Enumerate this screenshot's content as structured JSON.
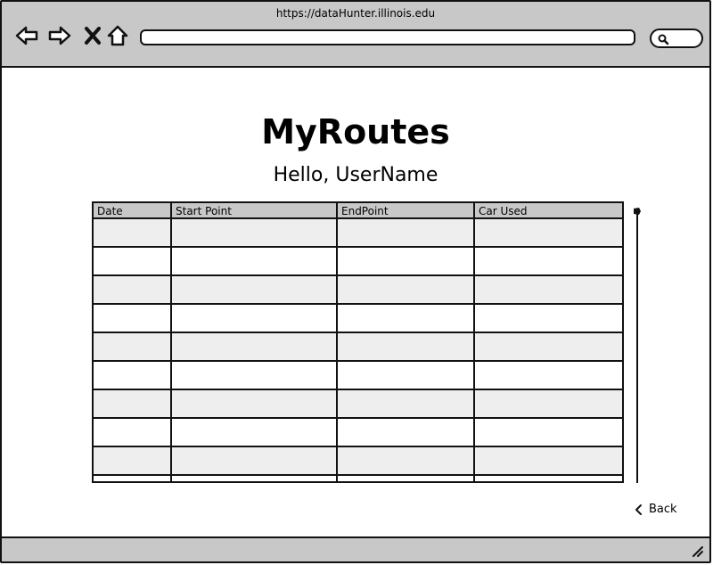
{
  "browser": {
    "url": "https://dataHunter.illinois.edu",
    "icons": [
      "back-arrow-icon",
      "forward-arrow-icon",
      "stop-icon",
      "home-icon",
      "search-icon"
    ]
  },
  "page": {
    "title": "MyRoutes",
    "greeting": "Hello, UserName"
  },
  "table": {
    "columns": [
      "Date",
      "Start Point",
      "EndPoint",
      "Car Used"
    ],
    "rows": [
      [
        "",
        "",
        "",
        ""
      ],
      [
        "",
        "",
        "",
        ""
      ],
      [
        "",
        "",
        "",
        ""
      ],
      [
        "",
        "",
        "",
        ""
      ],
      [
        "",
        "",
        "",
        ""
      ],
      [
        "",
        "",
        "",
        ""
      ],
      [
        "",
        "",
        "",
        ""
      ],
      [
        "",
        "",
        "",
        ""
      ],
      [
        "",
        "",
        "",
        ""
      ],
      [
        "",
        "",
        "",
        ""
      ]
    ]
  },
  "back_link": {
    "label": "Back",
    "icon": "chevron-left-icon"
  },
  "colors": {
    "chrome": "#c8c8c8",
    "stripe": "#eeeeee",
    "outline": "#111111"
  }
}
